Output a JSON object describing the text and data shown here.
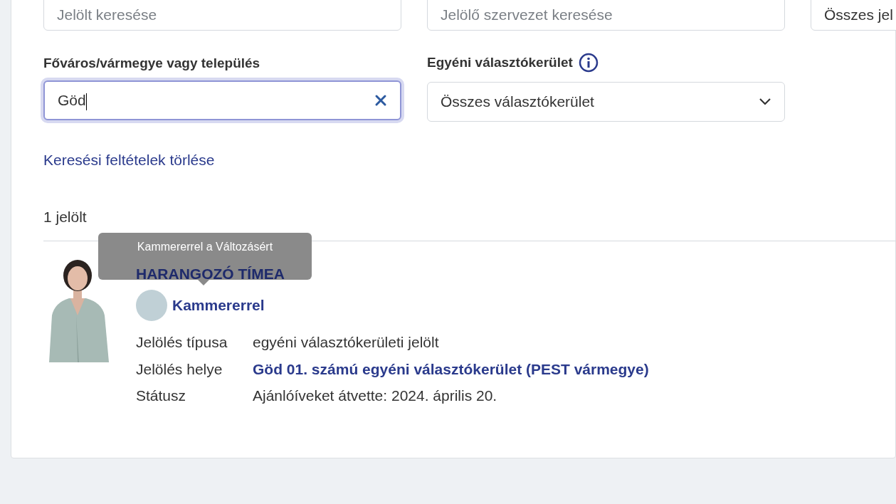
{
  "search_fields": [
    {
      "placeholder": "Jelölt keresése"
    },
    {
      "placeholder": "Jelölő szervezet keresése"
    },
    {
      "value": "Összes jel"
    }
  ],
  "location_filter": {
    "label": "Főváros/vármegye vagy település",
    "value": "Göd",
    "focused": true
  },
  "district_filter": {
    "label": "Egyéni választókerület",
    "value": "Összes választókerület"
  },
  "clear_link": "Keresési feltételek törlése",
  "result_count": "1 jelölt",
  "candidates": [
    {
      "name": "HARANGOZÓ TÍMEA",
      "organization": "Kammererrel",
      "tooltip": "Kammererrel a Változásért",
      "details": [
        {
          "label": "Jelölés típusa",
          "value": "egyéni választókerületi jelölt",
          "kind": "text"
        },
        {
          "label": "Jelölés helye",
          "value": "Göd 01. számú egyéni választókerület (PEST vármegye)",
          "kind": "link"
        },
        {
          "label": "Státusz",
          "value": "Ajánlóíveket átvette: 2024. április 20.",
          "kind": "text"
        }
      ]
    }
  ]
}
